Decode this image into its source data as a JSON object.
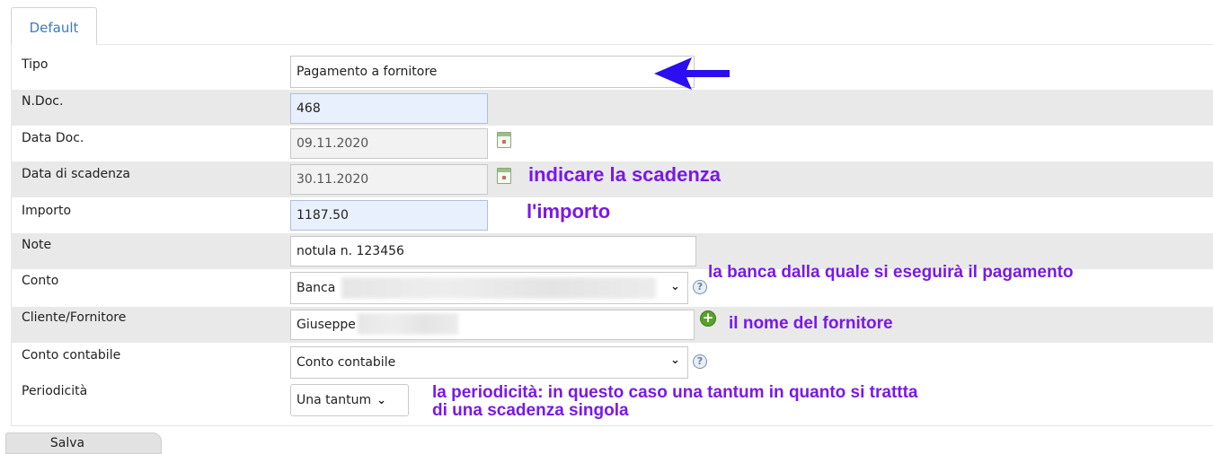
{
  "tab": {
    "label": "Default"
  },
  "form": {
    "tipo": {
      "label": "Tipo",
      "value": "Pagamento a fornitore"
    },
    "ndoc": {
      "label": "N.Doc.",
      "value": "468"
    },
    "data_doc": {
      "label": "Data Doc.",
      "value": "09.11.2020"
    },
    "data_scadenza": {
      "label": "Data di scadenza",
      "value": "30.11.2020"
    },
    "importo": {
      "label": "Importo",
      "value": "1187.50"
    },
    "note": {
      "label": "Note",
      "value": "notula n. 123456"
    },
    "conto": {
      "label": "Conto",
      "value": "Banca"
    },
    "cliente": {
      "label": "Cliente/Fornitore",
      "value": "Giuseppe"
    },
    "conto_contabile": {
      "label": "Conto contabile",
      "value": "Conto contabile"
    },
    "periodicita": {
      "label": "Periodicità",
      "value": "Una tantum"
    }
  },
  "annotations": {
    "scadenza": "indicare la scadenza",
    "importo": "l'importo",
    "banca": "la banca dalla quale si eseguirà il pagamento",
    "fornitore": "il nome del fornitore",
    "periodicita_line1": "la periodicità: in questo caso una tantum in quanto si trattta",
    "periodicita_line2": "di una scadenza singola"
  },
  "icons": {
    "calendar": "calendar-icon",
    "help": "help-icon",
    "add": "add-icon",
    "dropdown": "chevron-down-icon",
    "arrow": "arrow-left-icon"
  },
  "buttons": {
    "save": "Salva"
  },
  "colors": {
    "annotation": "#7a18e8",
    "arrow": "#2b0ff0",
    "tab_text": "#3a7bbf",
    "shaded_row": "#e9e9e9",
    "blue_field": "#e9f0fd"
  }
}
